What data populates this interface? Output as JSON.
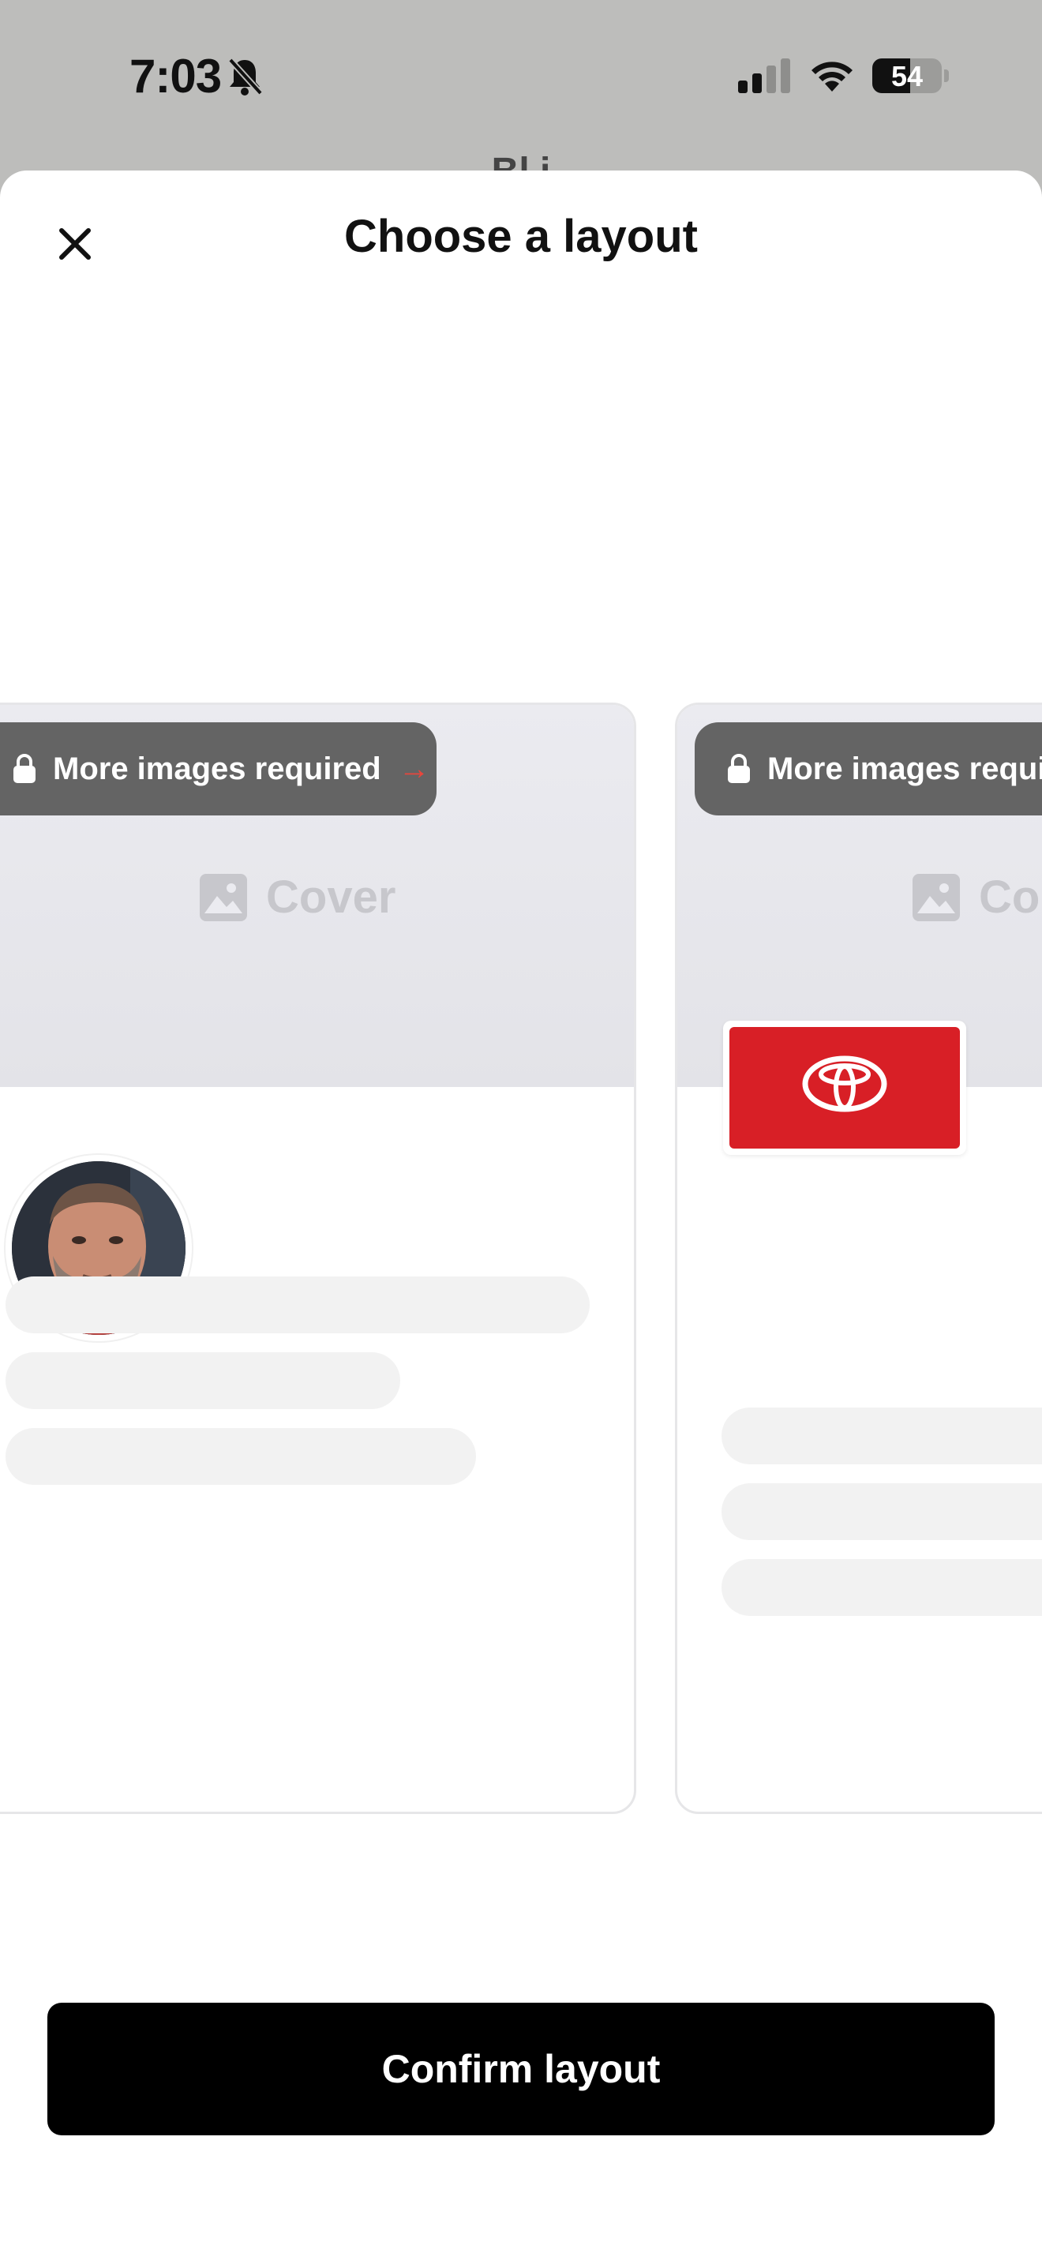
{
  "status_bar": {
    "time": "7:03",
    "battery": "54",
    "icons": [
      "bell-slash-icon",
      "cellular-signal-icon",
      "wifi-icon",
      "battery-icon"
    ]
  },
  "background_screen": {
    "title_fragment": "Bl      i"
  },
  "sheet": {
    "title": "Choose a layout",
    "close_icon": "close-icon"
  },
  "layouts": [
    {
      "badge": "More images required",
      "cover_label": "Cover",
      "profile": "round-avatar-photo"
    },
    {
      "badge": "More images requir",
      "cover_label": "Co",
      "profile": "square-logo"
    }
  ],
  "colors": {
    "badge_bg": "#646464",
    "arrow": "#e8463c",
    "logo_red": "#d81f26",
    "cta_bg": "#000000"
  },
  "actions": {
    "confirm_label": "Confirm layout"
  }
}
